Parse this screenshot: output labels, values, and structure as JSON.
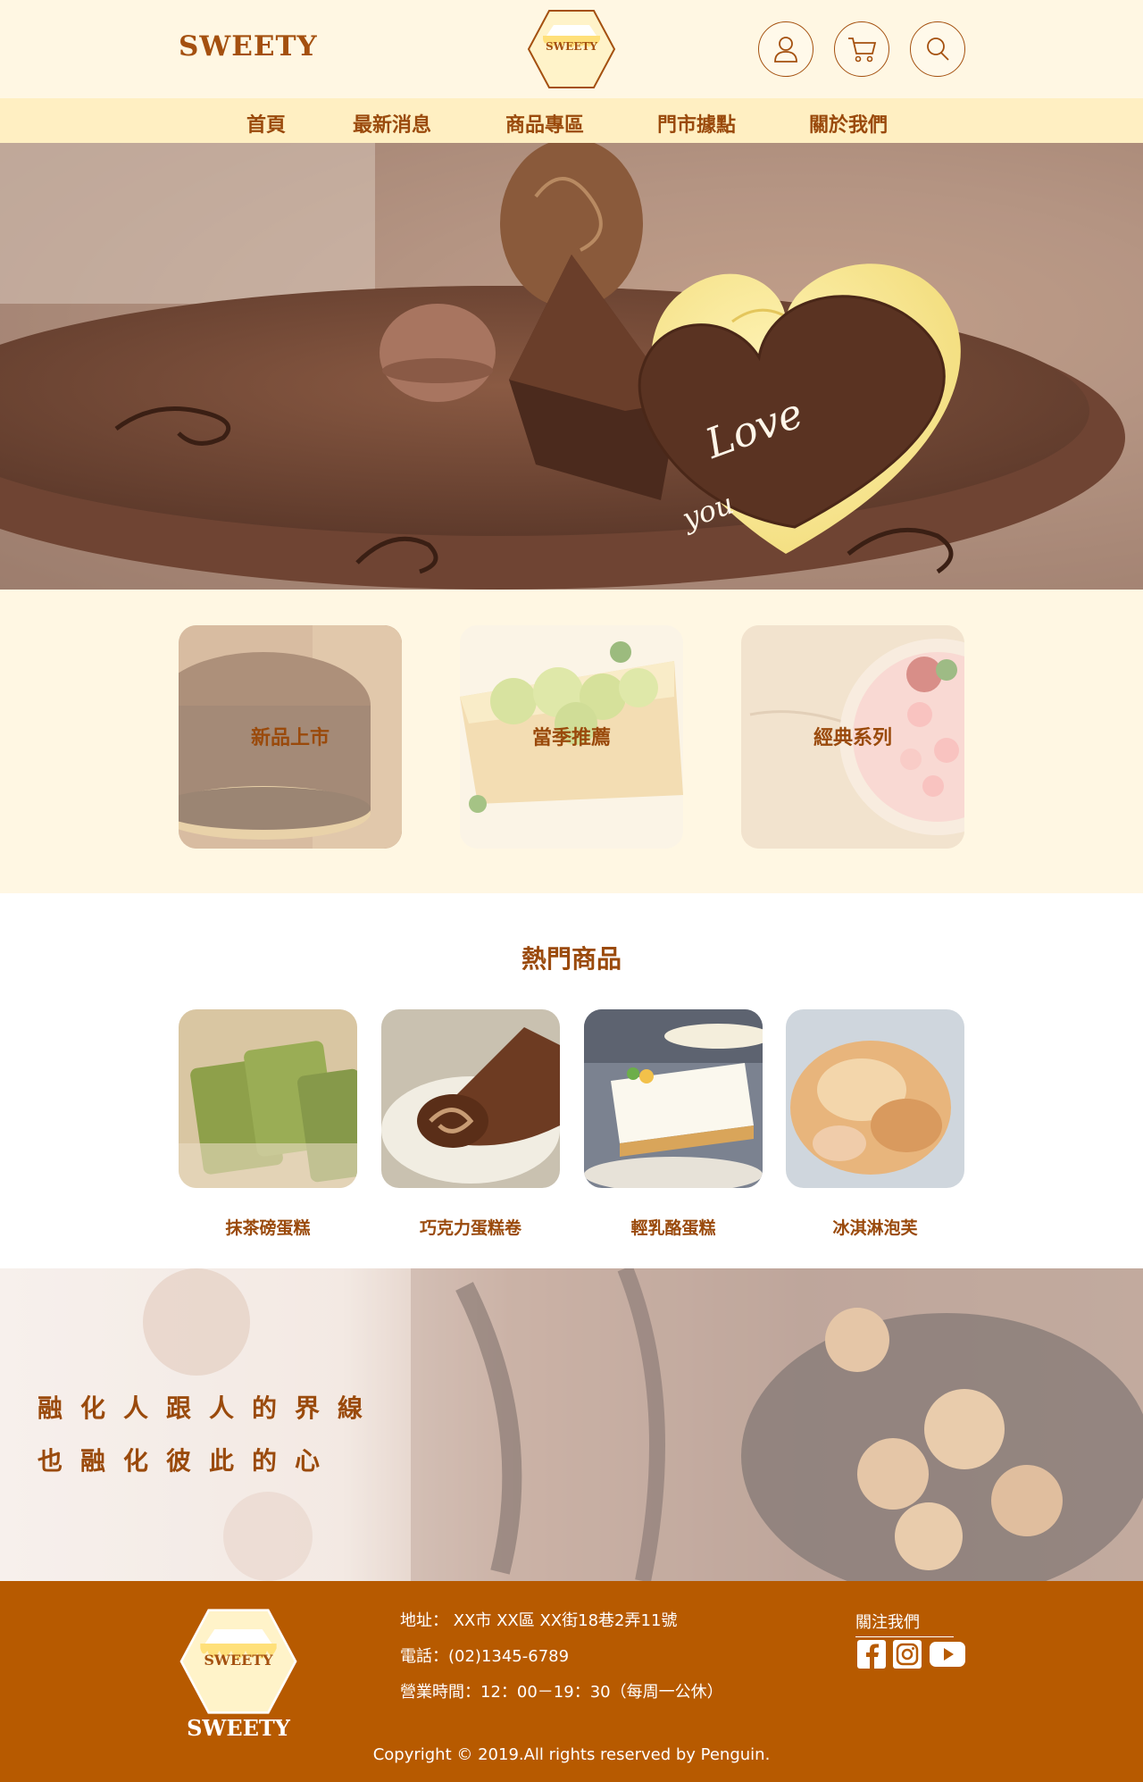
{
  "header": {
    "brand": "SWEETY",
    "logo_text": "SWEETY",
    "icons": [
      "user-icon",
      "cart-icon",
      "search-icon"
    ]
  },
  "nav": {
    "items": [
      {
        "label": "首頁"
      },
      {
        "label": "最新消息"
      },
      {
        "label": "商品專區"
      },
      {
        "label": "門市據點"
      },
      {
        "label": "關於我們"
      }
    ]
  },
  "hero": {
    "heart_text_1": "Love",
    "heart_text_2": "you"
  },
  "categories": [
    {
      "label": "新品上市"
    },
    {
      "label": "當季推薦"
    },
    {
      "label": "經典系列"
    }
  ],
  "hot": {
    "title": "熱門商品",
    "products": [
      {
        "name": "抹茶磅蛋糕"
      },
      {
        "name": "巧克力蛋糕卷"
      },
      {
        "name": "輕乳酪蛋糕"
      },
      {
        "name": "冰淇淋泡芙"
      }
    ]
  },
  "slogan": {
    "line1": "融化人跟人的界線",
    "line2": "也融化彼此的心"
  },
  "footer": {
    "logo_text": "SWEETY",
    "brand": "SWEETY",
    "address": "地址： XX市 XX區 XX街18巷2弄11號",
    "phone": "電話：(02)1345-6789",
    "hours": "營業時間：12：00－19：30（每周一公休）",
    "follow": "關注我們",
    "social": [
      "facebook-icon",
      "instagram-icon",
      "youtube-icon"
    ],
    "copyright": "Copyright © 2019.All rights reserved by Penguin."
  },
  "colors": {
    "brand_brown": "#9a4a0c",
    "header_bg": "#fff7e3",
    "nav_bg": "#ffefc2",
    "footer_bg": "#b75a00",
    "logo_yellow": "#ffe07a"
  }
}
